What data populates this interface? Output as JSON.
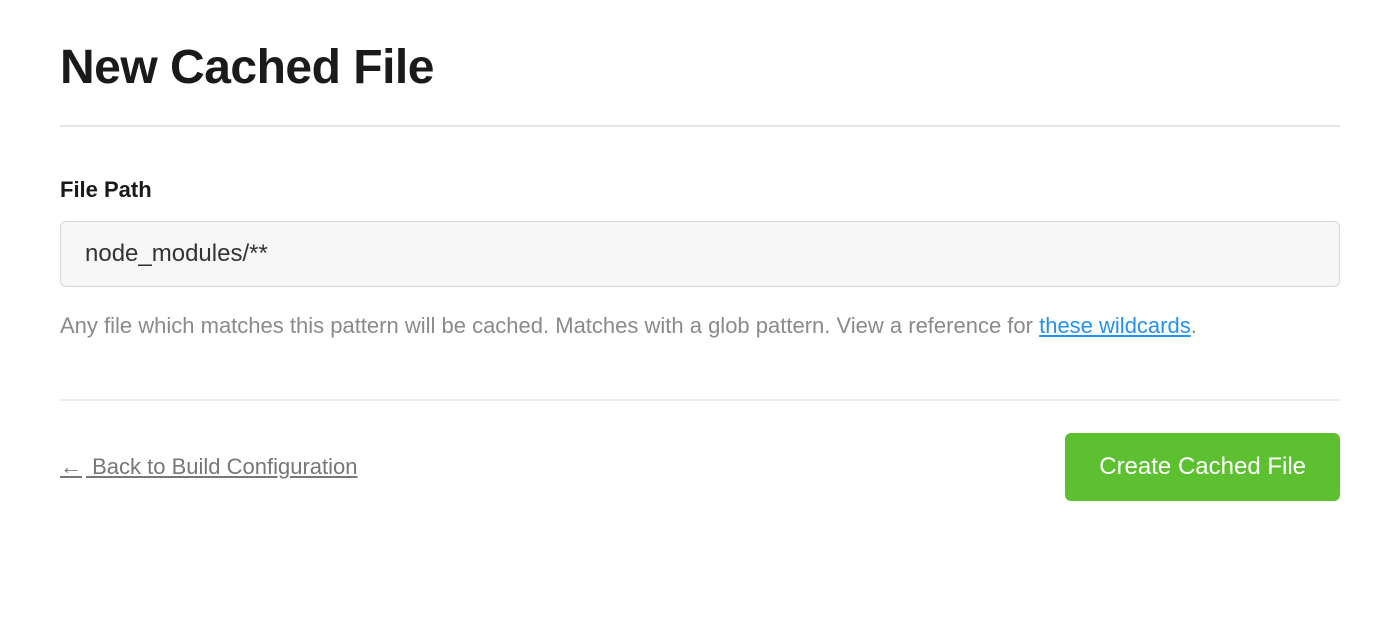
{
  "header": {
    "title": "New Cached File"
  },
  "form": {
    "file_path": {
      "label": "File Path",
      "value": "node_modules/**",
      "help_text_before": "Any file which matches this pattern will be cached. Matches with a glob pattern. View a reference for ",
      "help_link_text": "these wildcards",
      "help_text_after": "."
    }
  },
  "footer": {
    "back_arrow": "←",
    "back_label": " Back to Build Configuration",
    "create_label": "Create Cached File"
  }
}
